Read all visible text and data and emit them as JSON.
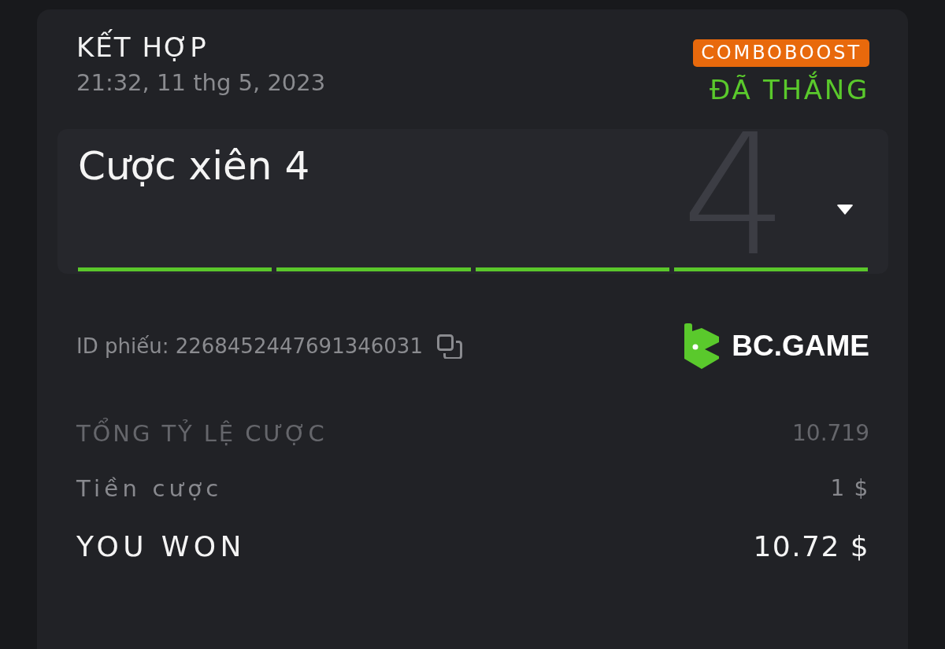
{
  "bet": {
    "type": "KẾT HỢP",
    "datetime": "21:32, 11 thg 5, 2023",
    "badge": "COMBOBOOST",
    "status": {
      "label": "ĐÃ THẮNG",
      "kind": "won"
    }
  },
  "combo": {
    "title": "Cược xiên 4",
    "big_number": "4",
    "expanded": false,
    "legs": [
      {
        "won": true
      },
      {
        "won": true
      },
      {
        "won": true
      },
      {
        "won": true
      }
    ]
  },
  "ticket": {
    "label": "ID phiếu: 2268452447691346031"
  },
  "brand": {
    "name": "BC.GAME"
  },
  "summary": [
    {
      "kind": "odds",
      "label": "TỔNG TỶ LỆ CƯỢC",
      "value": "10.719"
    },
    {
      "kind": "stake",
      "label": "Tiền cược",
      "value": "1 $"
    },
    {
      "kind": "payout",
      "label": "YOU WON",
      "value": "10.72 $"
    }
  ]
}
